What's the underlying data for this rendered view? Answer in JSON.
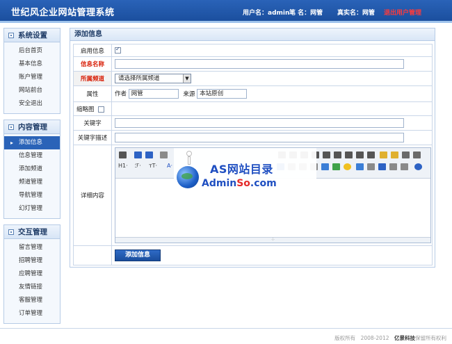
{
  "header": {
    "title": "世纪风企业网站管理系统",
    "user_label": "用户名：admin",
    "group_label": "笔 名：网管",
    "real_label": "真实名：网管",
    "logout": "退出用户管理"
  },
  "sidebar": {
    "groups": [
      {
        "title": "系统设置",
        "items": [
          "后台首页",
          "基本信息",
          "账户管理",
          "网站前台",
          "安全退出"
        ]
      },
      {
        "title": "内容管理",
        "items": [
          "添加信息",
          "信息管理",
          "添加频道",
          "频道管理",
          "导航管理",
          "幻灯管理"
        ]
      },
      {
        "title": "交互管理",
        "items": [
          "留言管理",
          "招聘管理",
          "应聘管理",
          "友情链接",
          "客服管理",
          "订单管理"
        ]
      }
    ]
  },
  "form": {
    "panel_title": "添加信息",
    "labels": {
      "enable": "启用信息",
      "name": "信息名称",
      "channel": "所属频道",
      "attr": "属性",
      "thumb": "缩略图",
      "keywords": "关键字",
      "desc": "关键字描述",
      "content": "详细内容"
    },
    "channel_select": "请选择所属频道",
    "author_label": "作者",
    "author_value": "网管",
    "source_label": "来源",
    "source_value": "本站原创",
    "submit": "添加信息"
  },
  "editor": {
    "row2": [
      "H1·",
      "ℱ·",
      "ᴛT·",
      "A·"
    ]
  },
  "watermark": {
    "line1": "AS网站目录",
    "line2_a": "Admin",
    "line2_b": "So",
    "line2_c": ".com"
  },
  "footer": {
    "text": "版权所有　2008-2012　",
    "brand": "亿景科技",
    "suffix": "保留所有权利"
  },
  "colors": {
    "header": "#1b4f9e",
    "accent": "#2a63b8",
    "required": "#d81e06",
    "logout": "#ff3a3a"
  }
}
